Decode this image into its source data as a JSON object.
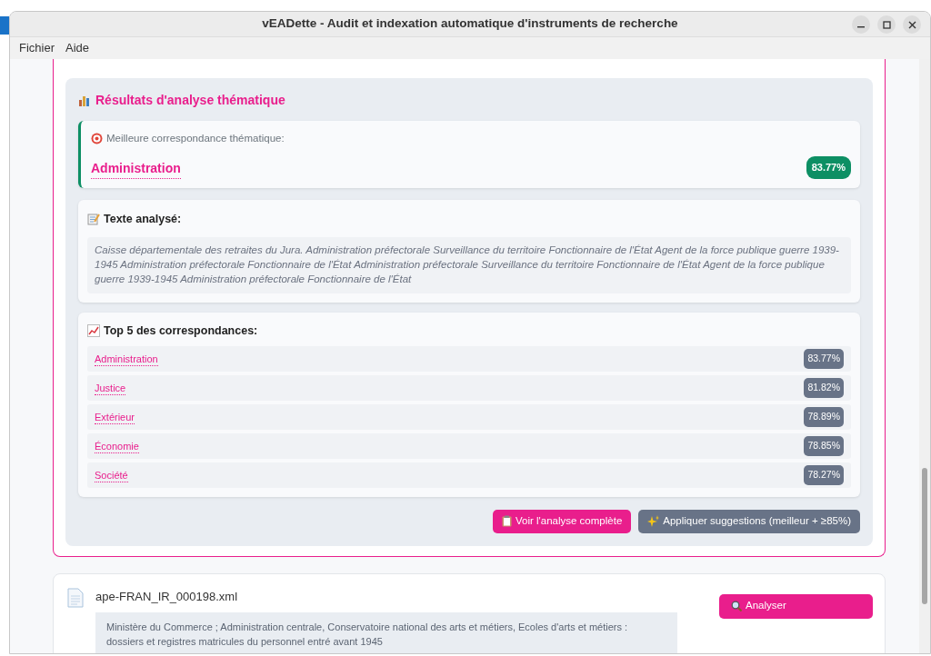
{
  "window": {
    "title": "vEADette - Audit et indexation automatique d'instruments de recherche"
  },
  "menu": [
    {
      "label": "Fichier"
    },
    {
      "label": "Aide"
    }
  ],
  "results": {
    "title": "Résultats d'analyse thématique",
    "best_match": {
      "label": "Meilleure correspondance thématique:",
      "theme": "Administration",
      "score": "83.77%"
    },
    "analyzed_text": {
      "title": "Texte analysé:",
      "text": "Caisse départementale des retraites du Jura. Administration préfectorale Surveillance du territoire Fonctionnaire de l'État Agent de la force publique guerre 1939-1945 Administration préfectorale Fonctionnaire de l'État Administration préfectorale Surveillance du territoire Fonctionnaire de l'État Agent de la force publique guerre 1939-1945 Administration préfectorale Fonctionnaire de l'État"
    },
    "top_matches": {
      "title": "Top 5 des correspondances:",
      "items": [
        {
          "theme": "Administration",
          "score": "83.77%"
        },
        {
          "theme": "Justice",
          "score": "81.82%"
        },
        {
          "theme": "Extérieur",
          "score": "78.89%"
        },
        {
          "theme": "Économie",
          "score": "78.85%"
        },
        {
          "theme": "Société",
          "score": "78.27%"
        }
      ]
    },
    "buttons": [
      {
        "kind": "primary",
        "label": "Voir l'analyse complète"
      },
      {
        "kind": "secondary",
        "label": "Appliquer suggestions (meilleur + ≥85%)"
      }
    ]
  },
  "files": [
    {
      "name": "ape-FRAN_IR_000198.xml",
      "description": "Ministère du Commerce ; Administration centrale, Conservatoire national des arts et métiers, Ecoles d'arts et métiers : dossiers et registres matricules du personnel entré avant 1945",
      "button": "Analyser"
    }
  ]
}
